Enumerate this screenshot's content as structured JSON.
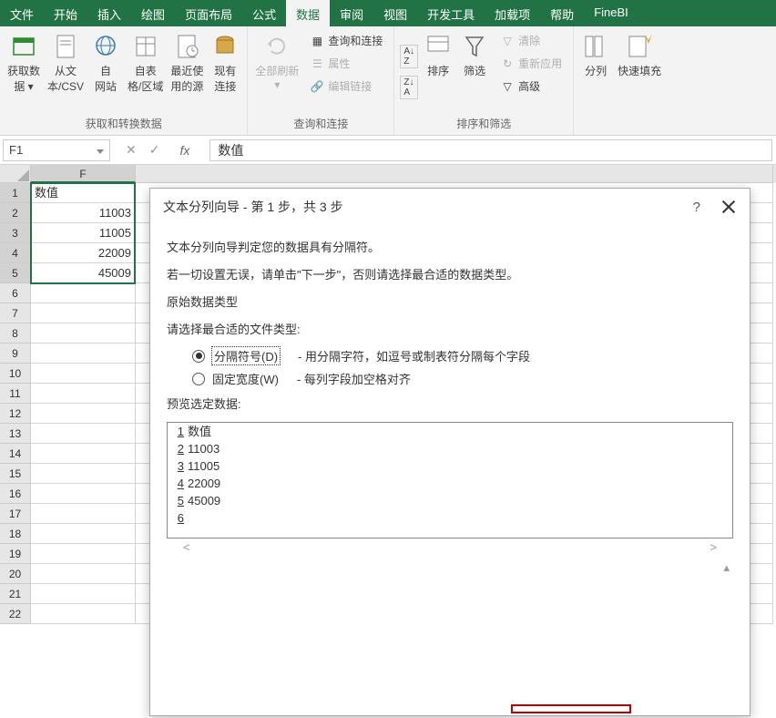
{
  "ribbon_tabs": [
    "文件",
    "开始",
    "插入",
    "绘图",
    "页面布局",
    "公式",
    "数据",
    "审阅",
    "视图",
    "开发工具",
    "加载项",
    "帮助",
    "FineBI"
  ],
  "active_tab_index": 6,
  "ribbon": {
    "group1_label": "获取和转换数据",
    "btn_getdata": "获取数\n据 ▾",
    "btn_fromtext": "从文\n本/CSV",
    "btn_fromweb": "自\n网站",
    "btn_fromtable": "自表\n格/区域",
    "btn_recent": "最近使\n用的源",
    "btn_existing": "现有\n连接",
    "group2_label": "查询和连接",
    "btn_refreshall": "全部刷新\n▾",
    "btn_queries": "查询和连接",
    "btn_props": "属性",
    "btn_editlinks": "编辑链接",
    "group3_label": "排序和筛选",
    "btn_az": "A↓Z",
    "btn_za": "Z↓A",
    "btn_sort": "排序",
    "btn_filter": "筛选",
    "btn_clear": "清除",
    "btn_reapply": "重新应用",
    "btn_advanced": "高级",
    "btn_texttocols": "分列",
    "btn_flashfill": "快速填充"
  },
  "namebox": "F1",
  "formula_value": "数值",
  "columns": [
    "F"
  ],
  "rows": [
    {
      "n": "1",
      "val": "数值",
      "type": "text",
      "active": true
    },
    {
      "n": "2",
      "val": "11003",
      "type": "num"
    },
    {
      "n": "3",
      "val": "11005",
      "type": "num"
    },
    {
      "n": "4",
      "val": "22009",
      "type": "num"
    },
    {
      "n": "5",
      "val": "45009",
      "type": "num"
    },
    {
      "n": "6",
      "val": ""
    },
    {
      "n": "7",
      "val": ""
    },
    {
      "n": "8",
      "val": ""
    },
    {
      "n": "9",
      "val": ""
    },
    {
      "n": "10",
      "val": ""
    },
    {
      "n": "11",
      "val": ""
    },
    {
      "n": "12",
      "val": ""
    },
    {
      "n": "13",
      "val": ""
    },
    {
      "n": "14",
      "val": ""
    },
    {
      "n": "15",
      "val": ""
    },
    {
      "n": "16",
      "val": ""
    },
    {
      "n": "17",
      "val": ""
    },
    {
      "n": "18",
      "val": ""
    },
    {
      "n": "19",
      "val": ""
    },
    {
      "n": "20",
      "val": ""
    },
    {
      "n": "21",
      "val": ""
    },
    {
      "n": "22",
      "val": ""
    }
  ],
  "dialog": {
    "title": "文本分列向导 - 第 1 步，共 3 步",
    "help": "?",
    "line1": "文本分列向导判定您的数据具有分隔符。",
    "line2": "若一切设置无误，请单击\"下一步\"，否则请选择最合适的数据类型。",
    "fieldset": "原始数据类型",
    "choose": "请选择最合适的文件类型:",
    "radio1_label": "分隔符号(D)",
    "radio1_desc": "- 用分隔字符，如逗号或制表符分隔每个字段",
    "radio2_label": "固定宽度(W)",
    "radio2_desc": "- 每列字段加空格对齐",
    "preview_label": "预览选定数据:",
    "preview_lines": [
      {
        "n": "1",
        "v": "数值"
      },
      {
        "n": "2",
        "v": "11003"
      },
      {
        "n": "3",
        "v": "11005"
      },
      {
        "n": "4",
        "v": "22009"
      },
      {
        "n": "5",
        "v": "45009"
      },
      {
        "n": "6",
        "v": ""
      }
    ]
  }
}
